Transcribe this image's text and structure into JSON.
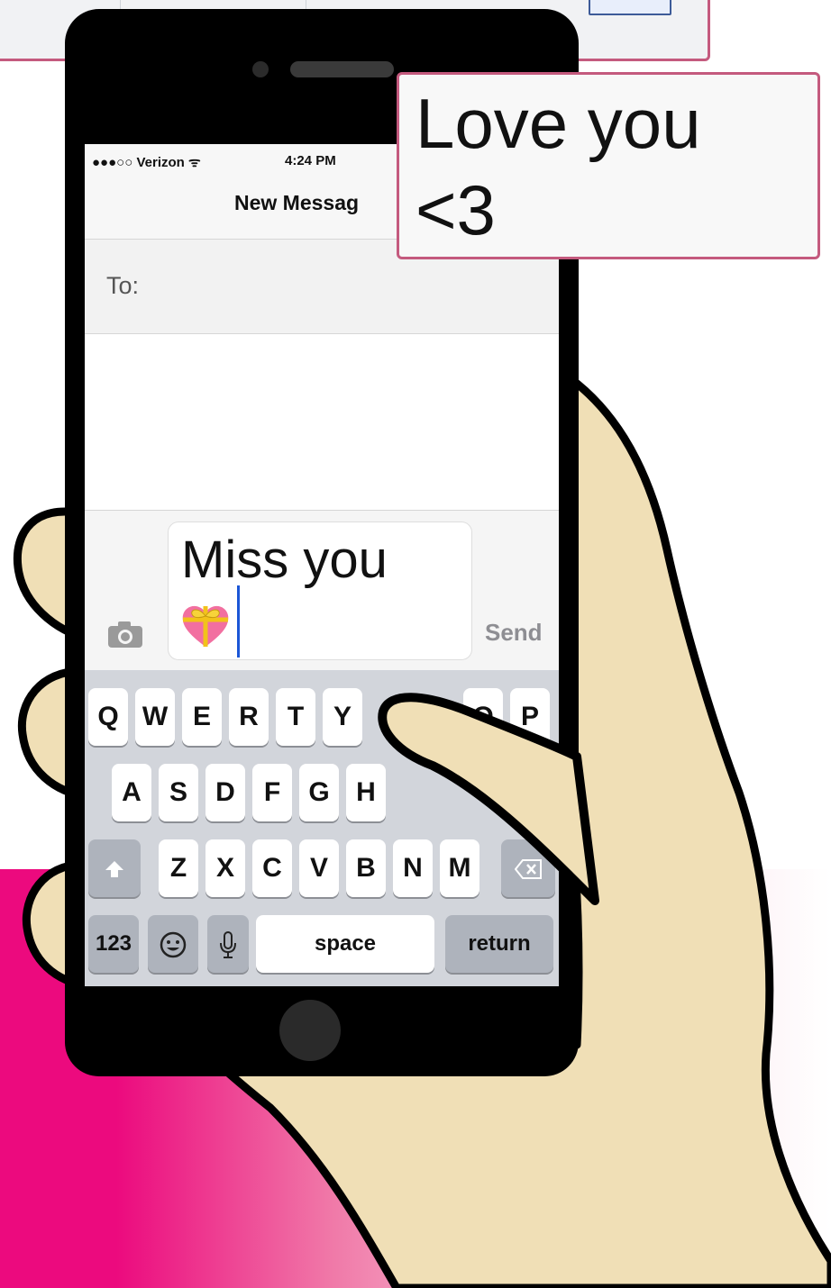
{
  "status_bar": {
    "carrier": "●●●○○ Verizon ᯤ",
    "time": "4:24 PM"
  },
  "navigation": {
    "title": "New Messag"
  },
  "recipient": {
    "label": "To:"
  },
  "compose": {
    "text": "Miss you",
    "send_label": "Send"
  },
  "keyboard": {
    "row1": [
      "Q",
      "W",
      "E",
      "R",
      "T",
      "Y",
      "O",
      "P"
    ],
    "row2": [
      "A",
      "S",
      "D",
      "F",
      "G",
      "H"
    ],
    "row3": [
      "Z",
      "X",
      "C",
      "V",
      "B",
      "N",
      "M"
    ],
    "numbers_label": "123",
    "space_label": "space",
    "return_label": "return"
  },
  "speech_bubble": {
    "text": "Love you\n<3"
  },
  "colors": {
    "accent_pink": "#ec0a7e",
    "frame_border": "#c45a7e",
    "hand_skin": "#f0dfb6",
    "caret_blue": "#1b56d6"
  },
  "icons": [
    "camera-icon",
    "heart-emoji-icon",
    "shift-icon",
    "emoji-icon",
    "microphone-icon",
    "delete-icon"
  ]
}
